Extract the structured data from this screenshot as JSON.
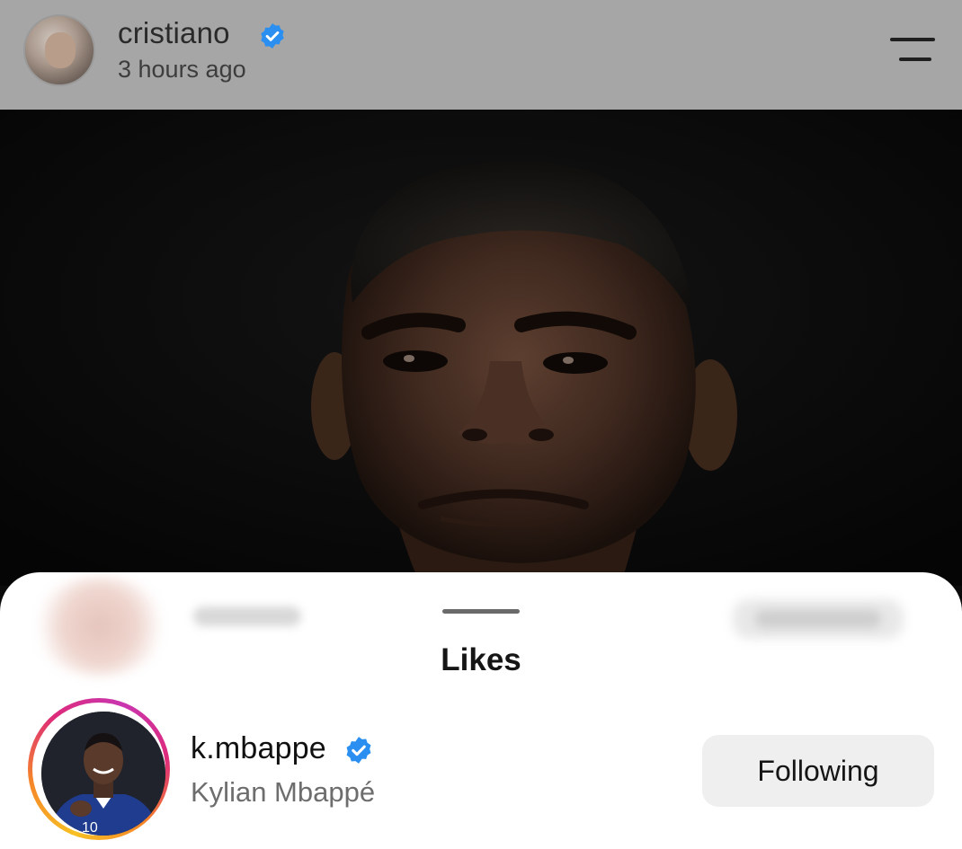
{
  "post": {
    "username": "cristiano",
    "timestamp": "3 hours ago",
    "verified": true,
    "avatar_icon": "profile-photo",
    "menu_icon": "menu-icon"
  },
  "sheet": {
    "title": "Likes"
  },
  "likes": [
    {
      "username": "k.mbappe",
      "full_name": "Kylian Mbappé",
      "verified": true,
      "button_label": "Following",
      "jersey_number": "10"
    }
  ],
  "colors": {
    "verified_blue": "#2a8ff0",
    "story_ring_start": "#f7c023",
    "story_ring_end": "#dd2a7b",
    "button_bg": "#efefef"
  }
}
